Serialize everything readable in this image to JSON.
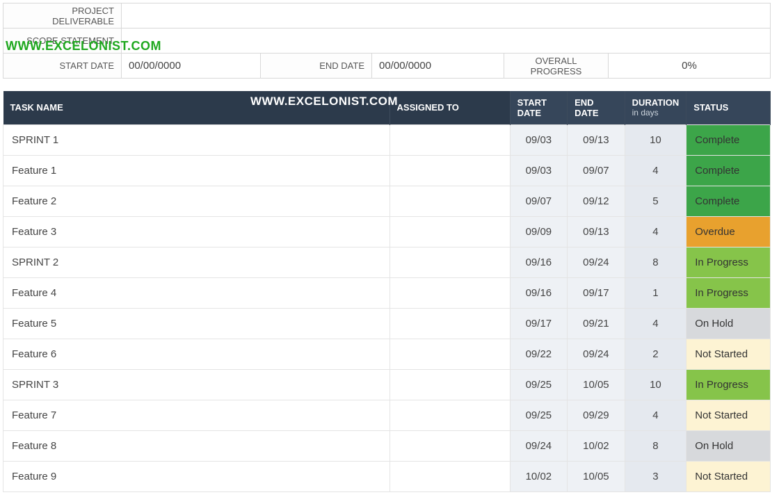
{
  "watermark": "WWW.EXCELONIST.COM",
  "header": {
    "labels": {
      "deliverable": "PROJECT DELIVERABLE",
      "scope": "SCOPE STATEMENT",
      "start": "START DATE",
      "end": "END DATE",
      "progress": "OVERALL PROGRESS"
    },
    "values": {
      "deliverable": "",
      "scope": "",
      "start": "00/00/0000",
      "end": "00/00/0000",
      "progress": "0%"
    }
  },
  "columns": {
    "task": "TASK NAME",
    "assigned": "ASSIGNED TO",
    "start": "START DATE",
    "end": "END DATE",
    "duration": "DURATION",
    "duration_sub": "in days",
    "status": "STATUS"
  },
  "status_styles": {
    "Complete": "s-complete",
    "Overdue": "s-overdue",
    "In Progress": "s-inprogress",
    "On Hold": "s-onhold",
    "Not Started": "s-notstarted"
  },
  "rows": [
    {
      "task": "SPRINT 1",
      "assigned": "",
      "start": "09/03",
      "end": "09/13",
      "duration": "10",
      "status": "Complete"
    },
    {
      "task": "Feature 1",
      "assigned": "",
      "start": "09/03",
      "end": "09/07",
      "duration": "4",
      "status": "Complete"
    },
    {
      "task": "Feature 2",
      "assigned": "",
      "start": "09/07",
      "end": "09/12",
      "duration": "5",
      "status": "Complete"
    },
    {
      "task": "Feature 3",
      "assigned": "",
      "start": "09/09",
      "end": "09/13",
      "duration": "4",
      "status": "Overdue"
    },
    {
      "task": "SPRINT 2",
      "assigned": "",
      "start": "09/16",
      "end": "09/24",
      "duration": "8",
      "status": "In Progress"
    },
    {
      "task": "Feature 4",
      "assigned": "",
      "start": "09/16",
      "end": "09/17",
      "duration": "1",
      "status": "In Progress"
    },
    {
      "task": "Feature 5",
      "assigned": "",
      "start": "09/17",
      "end": "09/21",
      "duration": "4",
      "status": "On Hold"
    },
    {
      "task": "Feature 6",
      "assigned": "",
      "start": "09/22",
      "end": "09/24",
      "duration": "2",
      "status": "Not Started"
    },
    {
      "task": "SPRINT 3",
      "assigned": "",
      "start": "09/25",
      "end": "10/05",
      "duration": "10",
      "status": "In Progress"
    },
    {
      "task": "Feature 7",
      "assigned": "",
      "start": "09/25",
      "end": "09/29",
      "duration": "4",
      "status": "Not Started"
    },
    {
      "task": "Feature 8",
      "assigned": "",
      "start": "09/24",
      "end": "10/02",
      "duration": "8",
      "status": "On Hold"
    },
    {
      "task": "Feature 9",
      "assigned": "",
      "start": "10/02",
      "end": "10/05",
      "duration": "3",
      "status": "Not Started"
    }
  ]
}
